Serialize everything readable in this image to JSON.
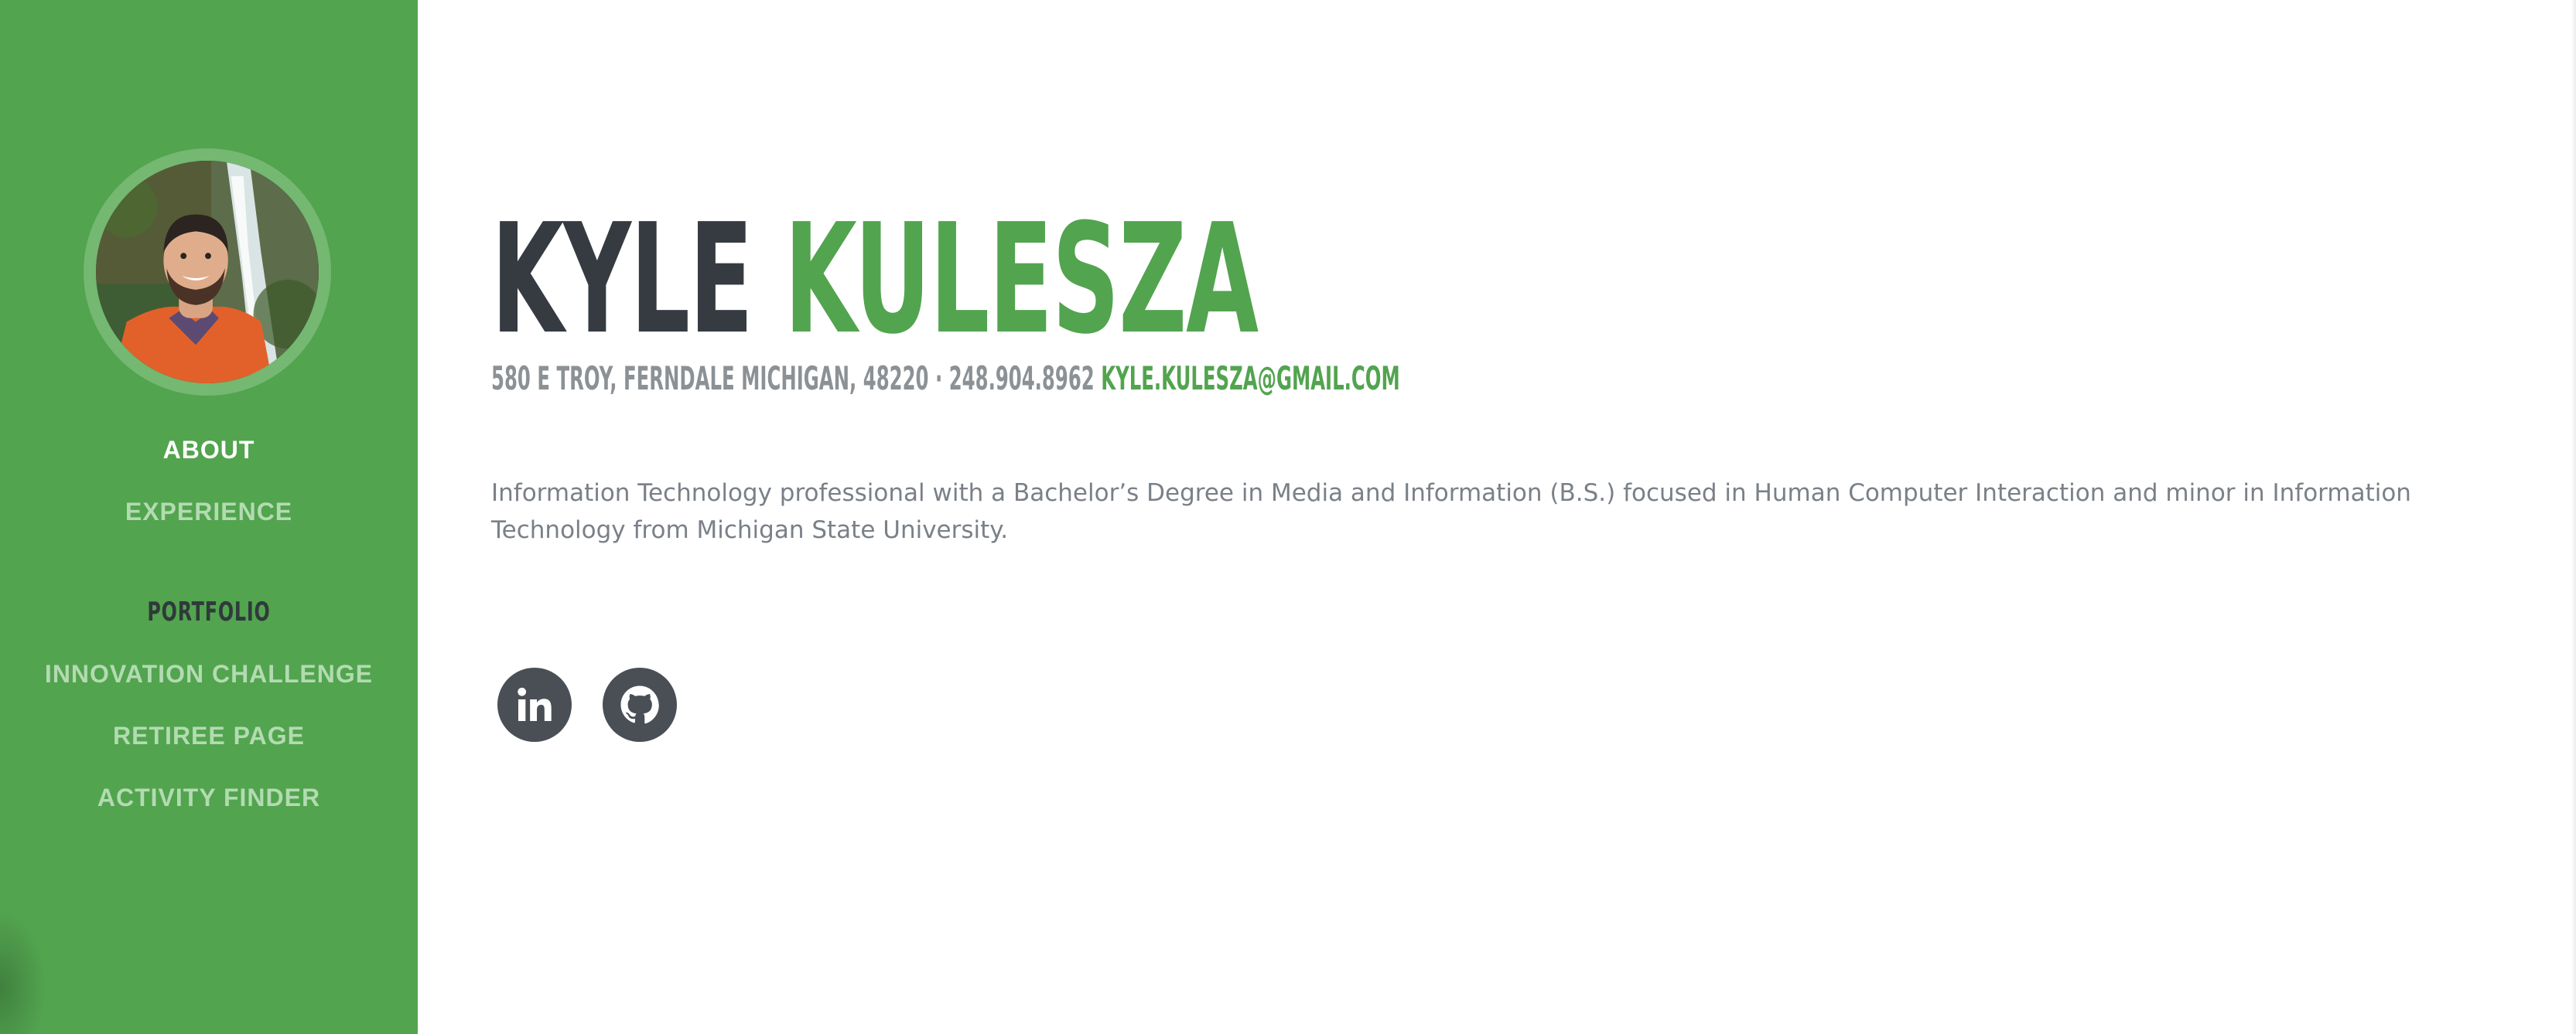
{
  "colors": {
    "sidebar_bg": "#52a44f",
    "accent": "#52a44f",
    "nav_inactive": "#b3dbb1",
    "nav_active": "#ffffff",
    "heading_dark": "#353b41",
    "text_muted": "#7a8087",
    "social_bg": "#4a4f55"
  },
  "sidebar": {
    "avatar_alt": "Profile photo",
    "nav": {
      "about": "About",
      "experience": "Experience",
      "portfolio_heading": "Portfolio",
      "innovation_challenge": "Innovation Challenge",
      "retiree_page": "Retiree Page",
      "activity_finder": "Activity Finder"
    }
  },
  "main": {
    "first_name": "Kyle",
    "last_name": "Kulesza",
    "address": "580 E Troy, Ferndale Michigan, 48220 · 248.904.8962",
    "email": "kyle.kulesza@gmail.com",
    "bio": "Information Technology professional with a Bachelor’s Degree in Media and Information (B.S.) focused in Human Computer Interaction and minor in Information Technology from Michigan State University.",
    "social": [
      {
        "icon": "linkedin-icon"
      },
      {
        "icon": "github-icon"
      }
    ]
  }
}
